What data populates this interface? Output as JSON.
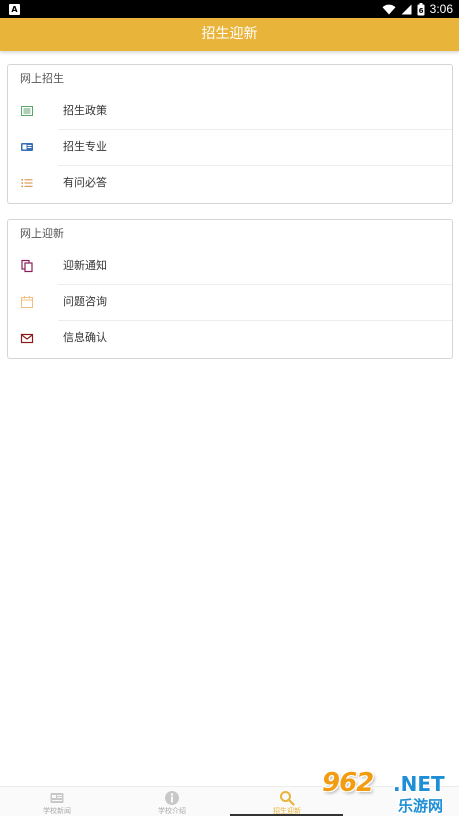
{
  "status_bar": {
    "left_icon_letter": "A",
    "time": "3:06",
    "battery_level": "6"
  },
  "header": {
    "title": "招生迎新"
  },
  "sections": [
    {
      "title": "网上招生",
      "items": [
        {
          "label": "招生政策",
          "icon": "list-doc-icon",
          "color": "#5aa66d"
        },
        {
          "label": "招生专业",
          "icon": "id-card-icon",
          "color": "#3b6fb5"
        },
        {
          "label": "有问必答",
          "icon": "ordered-list-icon",
          "color": "#d48a3a"
        }
      ]
    },
    {
      "title": "网上迎新",
      "items": [
        {
          "label": "迎新通知",
          "icon": "copy-icon",
          "color": "#8b1e5a"
        },
        {
          "label": "问题咨询",
          "icon": "calendar-icon",
          "color": "#f0c080"
        },
        {
          "label": "信息确认",
          "icon": "mail-icon",
          "color": "#8b1a1a"
        }
      ]
    }
  ],
  "tabs": [
    {
      "label": "学校新闻",
      "icon": "newspaper-icon",
      "active": false
    },
    {
      "label": "学校介绍",
      "icon": "info-icon",
      "active": false
    },
    {
      "label": "招生迎新",
      "icon": "search-icon",
      "active": true
    },
    {
      "label": "",
      "icon": "",
      "active": false
    }
  ],
  "watermark": {
    "number": "962",
    "suffix": ".NET",
    "brand": "乐游网"
  },
  "colors": {
    "accent": "#e9b43a",
    "active_tab": "#e9b43a"
  }
}
